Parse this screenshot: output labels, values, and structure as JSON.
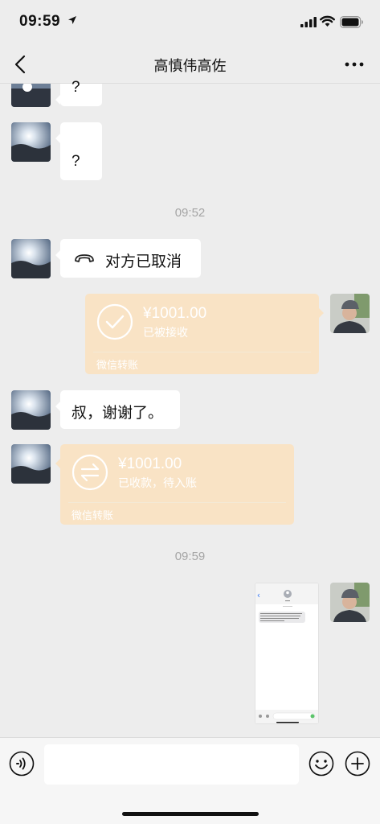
{
  "status_bar": {
    "time": "09:59"
  },
  "nav": {
    "title": "高慎伟高佐"
  },
  "messages": {
    "q1": "?",
    "q2": "?",
    "time1": "09:52",
    "call_cancelled": "对方已取消",
    "transfer1": {
      "amount": "¥1001.00",
      "status": "已被接收",
      "footer": "微信转账"
    },
    "thanks": "叔，谢谢了。",
    "transfer2": {
      "amount": "¥1001.00",
      "status": "已收款，待入账",
      "footer": "微信转账"
    },
    "time2": "09:59"
  },
  "input": {
    "value": "",
    "placeholder": ""
  },
  "colors": {
    "background": "#ededed",
    "transfer_bubble": "#f9e3c5",
    "timestamp": "#a5a5a5"
  }
}
